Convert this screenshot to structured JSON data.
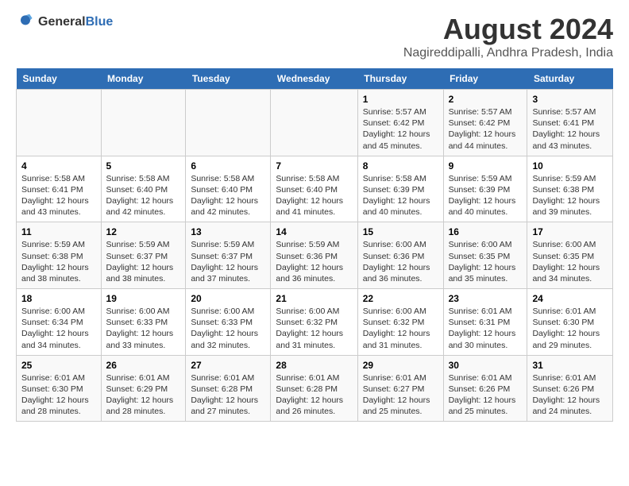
{
  "logo": {
    "text_general": "General",
    "text_blue": "Blue"
  },
  "title": "August 2024",
  "subtitle": "Nagireddipalli, Andhra Pradesh, India",
  "headers": [
    "Sunday",
    "Monday",
    "Tuesday",
    "Wednesday",
    "Thursday",
    "Friday",
    "Saturday"
  ],
  "weeks": [
    [
      {
        "day": "",
        "info": ""
      },
      {
        "day": "",
        "info": ""
      },
      {
        "day": "",
        "info": ""
      },
      {
        "day": "",
        "info": ""
      },
      {
        "day": "1",
        "info": "Sunrise: 5:57 AM\nSunset: 6:42 PM\nDaylight: 12 hours\nand 45 minutes."
      },
      {
        "day": "2",
        "info": "Sunrise: 5:57 AM\nSunset: 6:42 PM\nDaylight: 12 hours\nand 44 minutes."
      },
      {
        "day": "3",
        "info": "Sunrise: 5:57 AM\nSunset: 6:41 PM\nDaylight: 12 hours\nand 43 minutes."
      }
    ],
    [
      {
        "day": "4",
        "info": "Sunrise: 5:58 AM\nSunset: 6:41 PM\nDaylight: 12 hours\nand 43 minutes."
      },
      {
        "day": "5",
        "info": "Sunrise: 5:58 AM\nSunset: 6:40 PM\nDaylight: 12 hours\nand 42 minutes."
      },
      {
        "day": "6",
        "info": "Sunrise: 5:58 AM\nSunset: 6:40 PM\nDaylight: 12 hours\nand 42 minutes."
      },
      {
        "day": "7",
        "info": "Sunrise: 5:58 AM\nSunset: 6:40 PM\nDaylight: 12 hours\nand 41 minutes."
      },
      {
        "day": "8",
        "info": "Sunrise: 5:58 AM\nSunset: 6:39 PM\nDaylight: 12 hours\nand 40 minutes."
      },
      {
        "day": "9",
        "info": "Sunrise: 5:59 AM\nSunset: 6:39 PM\nDaylight: 12 hours\nand 40 minutes."
      },
      {
        "day": "10",
        "info": "Sunrise: 5:59 AM\nSunset: 6:38 PM\nDaylight: 12 hours\nand 39 minutes."
      }
    ],
    [
      {
        "day": "11",
        "info": "Sunrise: 5:59 AM\nSunset: 6:38 PM\nDaylight: 12 hours\nand 38 minutes."
      },
      {
        "day": "12",
        "info": "Sunrise: 5:59 AM\nSunset: 6:37 PM\nDaylight: 12 hours\nand 38 minutes."
      },
      {
        "day": "13",
        "info": "Sunrise: 5:59 AM\nSunset: 6:37 PM\nDaylight: 12 hours\nand 37 minutes."
      },
      {
        "day": "14",
        "info": "Sunrise: 5:59 AM\nSunset: 6:36 PM\nDaylight: 12 hours\nand 36 minutes."
      },
      {
        "day": "15",
        "info": "Sunrise: 6:00 AM\nSunset: 6:36 PM\nDaylight: 12 hours\nand 36 minutes."
      },
      {
        "day": "16",
        "info": "Sunrise: 6:00 AM\nSunset: 6:35 PM\nDaylight: 12 hours\nand 35 minutes."
      },
      {
        "day": "17",
        "info": "Sunrise: 6:00 AM\nSunset: 6:35 PM\nDaylight: 12 hours\nand 34 minutes."
      }
    ],
    [
      {
        "day": "18",
        "info": "Sunrise: 6:00 AM\nSunset: 6:34 PM\nDaylight: 12 hours\nand 34 minutes."
      },
      {
        "day": "19",
        "info": "Sunrise: 6:00 AM\nSunset: 6:33 PM\nDaylight: 12 hours\nand 33 minutes."
      },
      {
        "day": "20",
        "info": "Sunrise: 6:00 AM\nSunset: 6:33 PM\nDaylight: 12 hours\nand 32 minutes."
      },
      {
        "day": "21",
        "info": "Sunrise: 6:00 AM\nSunset: 6:32 PM\nDaylight: 12 hours\nand 31 minutes."
      },
      {
        "day": "22",
        "info": "Sunrise: 6:00 AM\nSunset: 6:32 PM\nDaylight: 12 hours\nand 31 minutes."
      },
      {
        "day": "23",
        "info": "Sunrise: 6:01 AM\nSunset: 6:31 PM\nDaylight: 12 hours\nand 30 minutes."
      },
      {
        "day": "24",
        "info": "Sunrise: 6:01 AM\nSunset: 6:30 PM\nDaylight: 12 hours\nand 29 minutes."
      }
    ],
    [
      {
        "day": "25",
        "info": "Sunrise: 6:01 AM\nSunset: 6:30 PM\nDaylight: 12 hours\nand 28 minutes."
      },
      {
        "day": "26",
        "info": "Sunrise: 6:01 AM\nSunset: 6:29 PM\nDaylight: 12 hours\nand 28 minutes."
      },
      {
        "day": "27",
        "info": "Sunrise: 6:01 AM\nSunset: 6:28 PM\nDaylight: 12 hours\nand 27 minutes."
      },
      {
        "day": "28",
        "info": "Sunrise: 6:01 AM\nSunset: 6:28 PM\nDaylight: 12 hours\nand 26 minutes."
      },
      {
        "day": "29",
        "info": "Sunrise: 6:01 AM\nSunset: 6:27 PM\nDaylight: 12 hours\nand 25 minutes."
      },
      {
        "day": "30",
        "info": "Sunrise: 6:01 AM\nSunset: 6:26 PM\nDaylight: 12 hours\nand 25 minutes."
      },
      {
        "day": "31",
        "info": "Sunrise: 6:01 AM\nSunset: 6:26 PM\nDaylight: 12 hours\nand 24 minutes."
      }
    ]
  ]
}
